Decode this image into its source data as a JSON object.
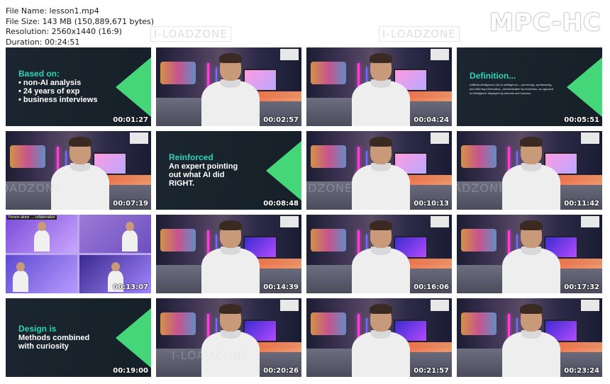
{
  "file_info": {
    "name": "File Name: lesson1.mp4",
    "size": "File Size: 143 MB (150,889,671 bytes)",
    "resolution": "Resolution: 2560x1440 (16:9)",
    "duration": "Duration: 00:24:51"
  },
  "brand": "MPC-HC",
  "watermark": "I-LOADZONE",
  "thumbnails": [
    {
      "time": "00:01:27",
      "type": "slide",
      "heading": "Based on:",
      "lines": [
        "• non-AI analysis",
        "• 24 years of exp",
        "• business interviews"
      ]
    },
    {
      "time": "00:02:57",
      "type": "studio"
    },
    {
      "time": "00:04:24",
      "type": "studio"
    },
    {
      "time": "00:05:51",
      "type": "slide",
      "heading": "Definition...",
      "text": "Artificial intelligence (AI) is intelligence— perceiving, synthesizing, and inferring information—demonstrated by machines, as opposed to intelligence displayed by animals and humans."
    },
    {
      "time": "00:07:19",
      "type": "studio"
    },
    {
      "time": "00:08:48",
      "type": "slide",
      "heading": "Reinforced",
      "lines": [
        "An expert pointing",
        "out what AI did",
        "RIGHT."
      ]
    },
    {
      "time": "00:10:13",
      "type": "studio"
    },
    {
      "time": "00:11:42",
      "type": "studio"
    },
    {
      "time": "00:13:07",
      "type": "collage",
      "caption": "Person alone → collaboration"
    },
    {
      "time": "00:14:39",
      "type": "studio"
    },
    {
      "time": "00:16:06",
      "type": "studio"
    },
    {
      "time": "00:17:32",
      "type": "studio"
    },
    {
      "time": "00:19:00",
      "type": "slide",
      "heading": "Design is",
      "lines": [
        "Methods combined",
        "with curiosity"
      ]
    },
    {
      "time": "00:20:26",
      "type": "studio"
    },
    {
      "time": "00:21:57",
      "type": "studio"
    },
    {
      "time": "00:23:24",
      "type": "studio"
    }
  ]
}
